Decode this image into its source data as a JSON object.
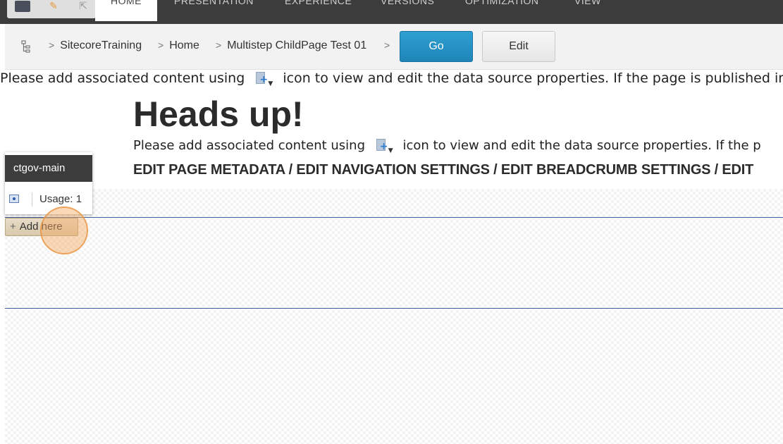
{
  "ribbon": {
    "tabs": [
      "HOME",
      "PRESENTATION",
      "EXPERIENCE",
      "VERSIONS",
      "OPTIMIZATION",
      "VIEW"
    ],
    "active_tab": "HOME"
  },
  "breadcrumb": {
    "items": [
      "SitecoreTraining",
      "Home",
      "Multistep ChildPage Test 01"
    ],
    "separator": ">",
    "go_label": "Go",
    "edit_label": "Edit"
  },
  "info": {
    "text_before": "Please add associated content using",
    "text_after": "icon to view and edit the data source properties. If the page is published in"
  },
  "main": {
    "heading": "Heads up!",
    "text_before": "Please add associated content using",
    "text_after": "icon to view and edit the data source properties. If the p",
    "links": "EDIT PAGE METADATA / EDIT NAVIGATION SETTINGS / EDIT BREADCRUMB SETTINGS / EDIT"
  },
  "placeholder": {
    "name": "ctgov-main",
    "usage": "Usage: 1",
    "add_here": "Add here"
  },
  "colors": {
    "ribbon_bg": "#3c3c3c",
    "go_button": "#2f9fd1",
    "add_here_bg": "#d9c9ac",
    "click_marker": "#f5aa64"
  }
}
